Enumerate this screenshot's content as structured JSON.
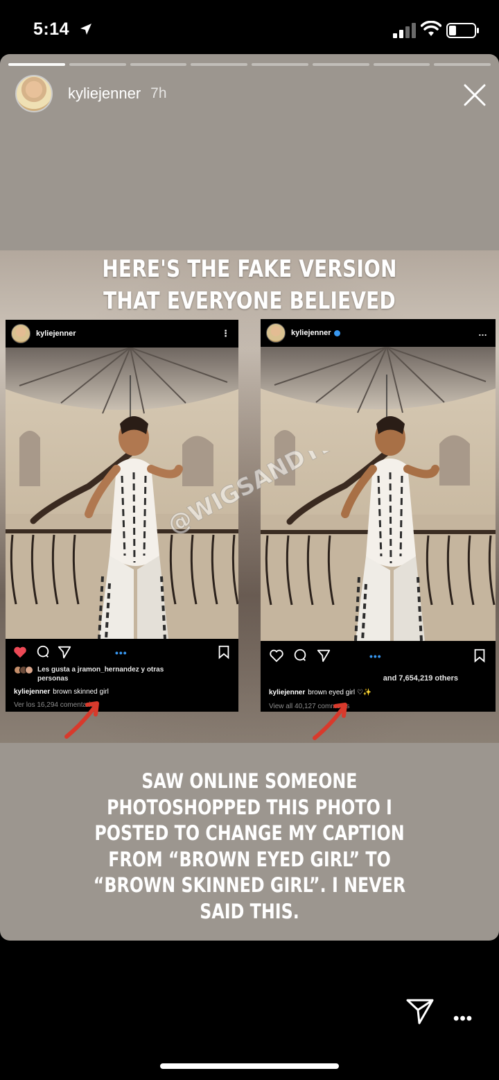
{
  "status_bar": {
    "time": "5:14"
  },
  "story": {
    "progress_segments": 8,
    "progress_done": 1,
    "username": "kyliejenner",
    "age": "7h",
    "headline_lines": [
      "HERE'S THE FAKE VERSION",
      "THAT EVERYONE BELIEVED"
    ],
    "watermark": "@WIGSANDTEA",
    "body_lines": [
      "SAW ONLINE SOMEONE",
      "PHOTOSHOPPED THIS PHOTO I",
      "POSTED TO CHANGE MY CAPTION",
      "FROM “BROWN EYED GIRL” TO",
      "“BROWN SKINNED GIRL”. I NEVER",
      "SAID THIS."
    ]
  },
  "fake_post": {
    "username": "kyliejenner",
    "likes_line1": "Les gusta a jramon_hernandez y otras",
    "likes_line2": "personas",
    "caption_user": "kyliejenner",
    "caption_text": "brown skinned girl",
    "comments": "Ver los 16,294 comentarios"
  },
  "real_post": {
    "username": "kyliejenner",
    "likes_line": "and 7,654,219 others",
    "caption_user": "kyliejenner",
    "caption_text": "brown eyed girl",
    "comments": "View all 40,127 comments"
  },
  "colors": {
    "story_bg": "#9c968f",
    "like_red": "#ed4956",
    "verified_blue": "#3897f0",
    "arrow_red": "#d83a2c"
  }
}
